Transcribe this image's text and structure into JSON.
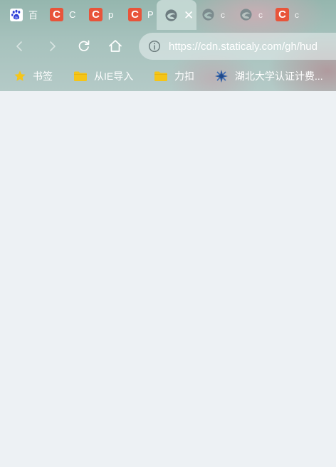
{
  "tabs": [
    {
      "title": "百",
      "icon": "baidu-paw-icon",
      "active": false
    },
    {
      "title": "C",
      "icon": "csdn-icon",
      "active": false
    },
    {
      "title": "p",
      "icon": "csdn-icon",
      "active": false
    },
    {
      "title": "P",
      "icon": "csdn-icon",
      "active": false
    },
    {
      "title": "",
      "icon": "edge-globe-icon",
      "active": true,
      "close": "✕"
    },
    {
      "title": "c",
      "icon": "edge-globe-icon",
      "active": false
    },
    {
      "title": "c",
      "icon": "edge-globe-icon",
      "active": false
    },
    {
      "title": "c",
      "icon": "csdn-icon",
      "active": false
    }
  ],
  "toolbar": {
    "url": "https://cdn.staticaly.com/gh/hud"
  },
  "bookmarks": {
    "items": [
      {
        "label": "书签",
        "icon": "star-icon"
      },
      {
        "label": "从IE导入",
        "icon": "folder-icon"
      },
      {
        "label": "力扣",
        "icon": "folder-icon"
      },
      {
        "label": "湖北大学认证计费...",
        "icon": "hubu-logo-icon"
      }
    ]
  },
  "colors": {
    "csdn": "#e8543a",
    "folder": "#f5c518",
    "star": "#f5c518",
    "page_background": "#edf1f4"
  }
}
